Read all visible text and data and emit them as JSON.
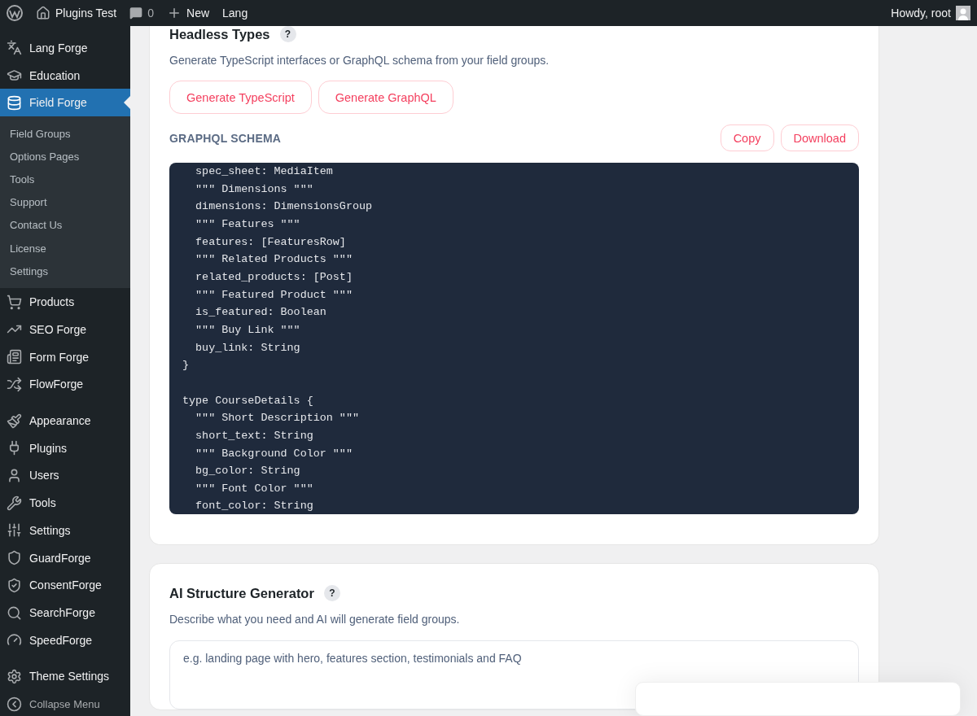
{
  "admin_bar": {
    "site": "Plugins Test",
    "comments": "0",
    "new": "New",
    "lang": "Lang",
    "greeting": "Howdy, root"
  },
  "sidebar": {
    "items": [
      {
        "label": "Lang Forge",
        "selected": false
      },
      {
        "label": "Education",
        "selected": false
      },
      {
        "label": "Field Forge",
        "selected": true,
        "children": [
          {
            "label": "Field Groups",
            "selected": false
          },
          {
            "label": "Options Pages",
            "selected": false
          },
          {
            "label": "Tools",
            "selected": false
          },
          {
            "label": "Support",
            "selected": false
          },
          {
            "label": "Contact Us",
            "selected": false
          },
          {
            "label": "License",
            "selected": false
          },
          {
            "label": "Settings",
            "selected": false
          }
        ]
      },
      {
        "label": "Products",
        "selected": false
      },
      {
        "label": "SEO Forge",
        "selected": false
      },
      {
        "label": "Form Forge",
        "selected": false
      },
      {
        "label": "FlowForge",
        "selected": false
      },
      {
        "label": "Appearance",
        "selected": false
      },
      {
        "label": "Plugins",
        "selected": false
      },
      {
        "label": "Users",
        "selected": false
      },
      {
        "label": "Tools",
        "selected": false
      },
      {
        "label": "Settings",
        "selected": false
      },
      {
        "label": "GuardForge",
        "selected": false
      },
      {
        "label": "ConsentForge",
        "selected": false
      },
      {
        "label": "SearchForge",
        "selected": false
      },
      {
        "label": "SpeedForge",
        "selected": false
      },
      {
        "label": "Theme Settings",
        "selected": false
      }
    ],
    "collapse": "Collapse Menu"
  },
  "headless_types": {
    "title": "Headless Types",
    "help": "?",
    "description": "Generate TypeScript interfaces or GraphQL schema from your field groups.",
    "buttons": [
      "Generate TypeScript",
      "Generate GraphQL"
    ],
    "schema_label": "GRAPHQL SCHEMA",
    "actions": [
      "Copy",
      "Download"
    ],
    "code": "  spec_sheet: MediaItem\n  \"\"\" Dimensions \"\"\"\n  dimensions: DimensionsGroup\n  \"\"\" Features \"\"\"\n  features: [FeaturesRow]\n  \"\"\" Related Products \"\"\"\n  related_products: [Post]\n  \"\"\" Featured Product \"\"\"\n  is_featured: Boolean\n  \"\"\" Buy Link \"\"\"\n  buy_link: String\n}\n\ntype CourseDetails {\n  \"\"\" Short Description \"\"\"\n  short_text: String\n  \"\"\" Background Color \"\"\"\n  bg_color: String\n  \"\"\" Font Color \"\"\"\n  font_color: String"
  },
  "ai_generator": {
    "title": "AI Structure Generator",
    "help": "?",
    "description": "Describe what you need and AI will generate field groups.",
    "placeholder": "e.g. landing page with hero, features section, testimonials and FAQ"
  }
}
